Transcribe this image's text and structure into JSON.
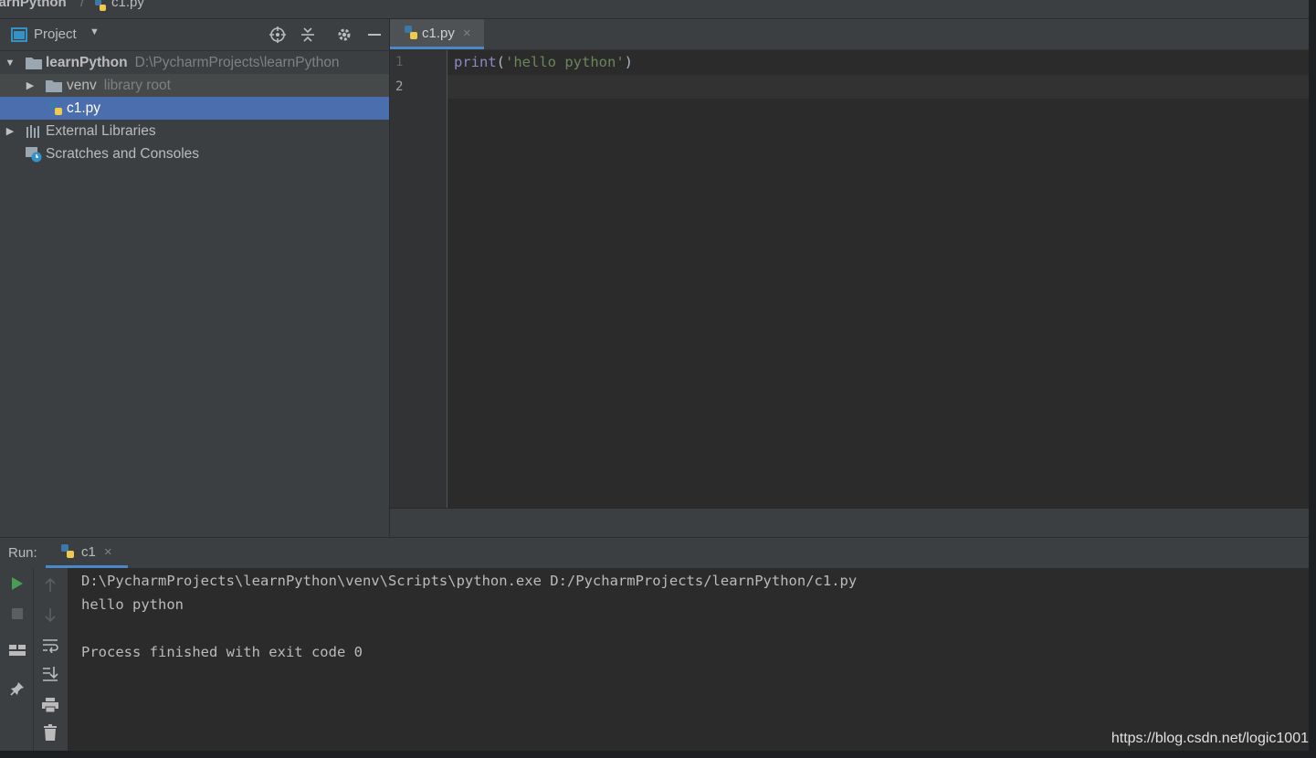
{
  "breadcrumb": {
    "project": "learnPython",
    "separator": "/",
    "file": "c1.py"
  },
  "project_panel": {
    "title": "Project",
    "tree": {
      "root": {
        "name": "learnPython",
        "path": "D:\\PycharmProjects\\learnPython"
      },
      "venv": {
        "name": "venv",
        "note": "library root"
      },
      "file": {
        "name": "c1.py"
      },
      "external": {
        "name": "External Libraries"
      },
      "scratches": {
        "name": "Scratches and Consoles"
      }
    }
  },
  "editor": {
    "tab": {
      "label": "c1.py",
      "close": "×"
    },
    "line_numbers": [
      "1",
      "2"
    ],
    "code": {
      "fn": "print",
      "open": "(",
      "string": "'hello python'",
      "close": ")"
    }
  },
  "run_panel": {
    "label": "Run:",
    "tab": {
      "label": "c1",
      "close": "×"
    },
    "output": [
      "D:\\PycharmProjects\\learnPython\\venv\\Scripts\\python.exe D:/PycharmProjects/learnPython/c1.py",
      "hello python",
      "",
      "Process finished with exit code 0"
    ]
  },
  "watermark": "https://blog.csdn.net/logic1001",
  "colors": {
    "selection": "#4b6eaf",
    "keyword": "#8888c6",
    "string": "#6a8759",
    "run_green": "#499c54",
    "tab_underline": "#4a88c7"
  }
}
